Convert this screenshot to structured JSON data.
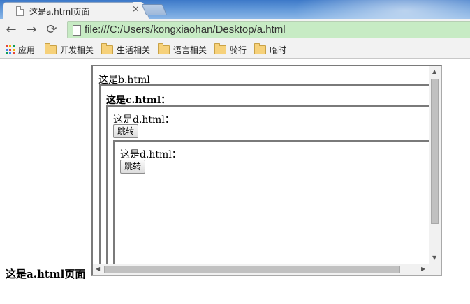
{
  "browser": {
    "tab_title": "这是a.html页面",
    "tab_close": "×",
    "nav": {
      "back": "←",
      "forward": "→",
      "reload": "⟳"
    },
    "address": "file:///C:/Users/kongxiaohan/Desktop/a.html"
  },
  "bookmarks": [
    {
      "label": "应用",
      "icon": "apps-icon"
    },
    {
      "label": "开发相关",
      "icon": "folder-icon"
    },
    {
      "label": "生活相关",
      "icon": "folder-icon"
    },
    {
      "label": "语言相关",
      "icon": "folder-icon"
    },
    {
      "label": "骑行",
      "icon": "folder-icon"
    },
    {
      "label": "临时",
      "icon": "folder-icon"
    }
  ],
  "page": {
    "a_label": "这是a.html页面",
    "b_label": "这是b.html",
    "c_label": "这是c.html：",
    "d_label": "这是d.html：",
    "d_button": "跳转",
    "d2_label": "这是d.html：",
    "d2_button": "跳转"
  },
  "colors": {
    "omnibox_bg": "#c7ebc4",
    "titlebar": "#3d79c8"
  }
}
